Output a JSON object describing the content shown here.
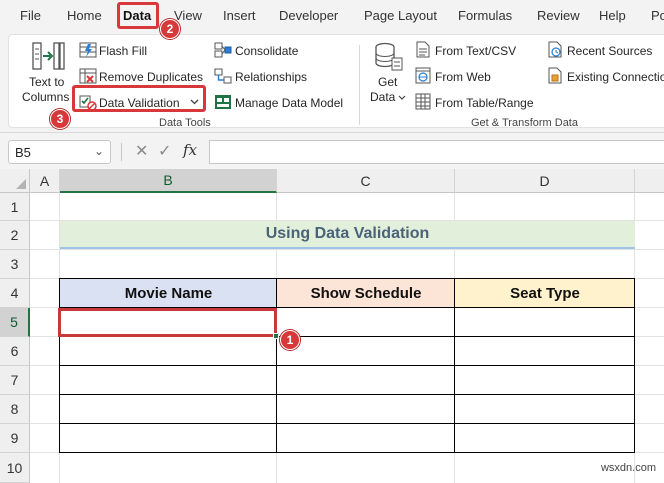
{
  "menu": {
    "items": [
      "File",
      "Home",
      "Data",
      "View",
      "Insert",
      "Developer",
      "Page Layout",
      "Formulas",
      "Review",
      "Help",
      "Po"
    ],
    "active": "Data"
  },
  "ribbon": {
    "text_to_columns": [
      "Text to",
      "Columns"
    ],
    "flash_fill": "Flash Fill",
    "remove_duplicates": "Remove Duplicates",
    "data_validation": "Data Validation",
    "consolidate": "Consolidate",
    "relationships": "Relationships",
    "manage_data_model": "Manage Data Model",
    "data_tools_group": "Data Tools",
    "get_data": [
      "Get",
      "Data"
    ],
    "from_text_csv": "From Text/CSV",
    "from_web": "From Web",
    "from_table_range": "From Table/Range",
    "recent_sources": "Recent Sources",
    "existing_connections": "Existing Connectio",
    "get_transform_group": "Get & Transform Data"
  },
  "formula_bar": {
    "name_box": "B5",
    "fx": "fx",
    "value": ""
  },
  "columns": [
    "A",
    "B",
    "C",
    "D"
  ],
  "rows": [
    "1",
    "2",
    "3",
    "4",
    "5",
    "6",
    "7",
    "8",
    "9",
    "10"
  ],
  "sheet": {
    "title": "Using Data Validation",
    "headers": [
      "Movie Name",
      "Show Schedule",
      "Seat Type"
    ],
    "header_colors": [
      "#d9e1f2",
      "#fce4d6",
      "#fff2cc"
    ],
    "selected_cell": "B5"
  },
  "annotations": [
    "1",
    "2",
    "3"
  ],
  "watermark": "wsxdn.com",
  "colors": {
    "accent": "#217346",
    "highlight": "#d9383a"
  }
}
